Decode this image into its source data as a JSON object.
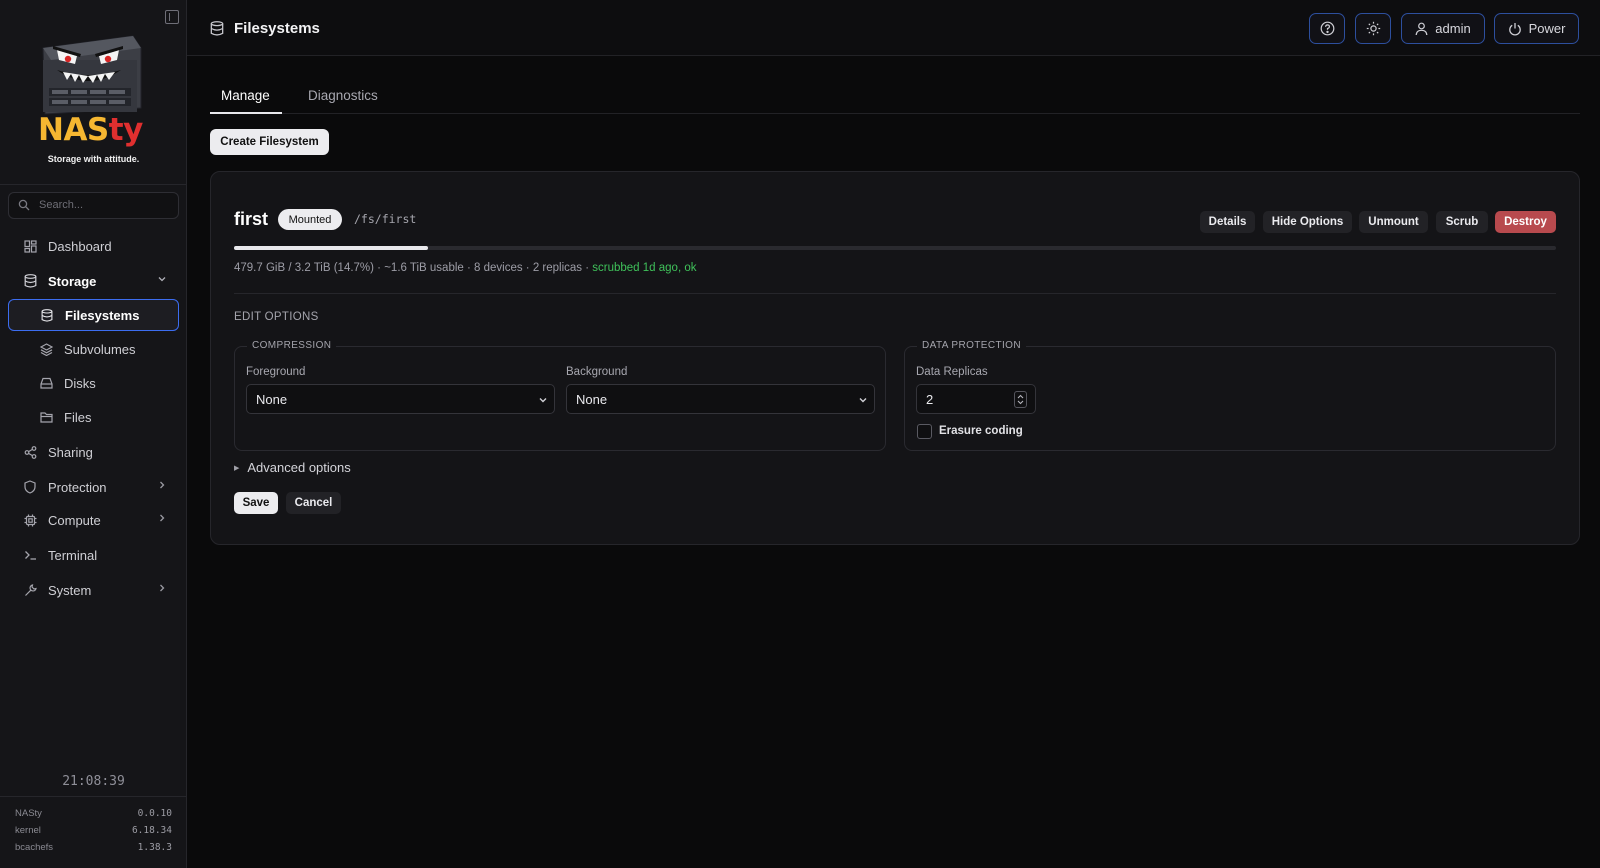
{
  "brand": {
    "name_main": "NAS",
    "name_accent": "ty",
    "tagline": "Storage with attitude."
  },
  "sidebar": {
    "search_placeholder": "Search...",
    "items": [
      {
        "label": "Dashboard",
        "icon": "dashboard-icon"
      },
      {
        "label": "Storage",
        "icon": "database-icon",
        "expanded": true
      },
      {
        "label": "Filesystems",
        "icon": "database-icon",
        "active": true
      },
      {
        "label": "Subvolumes",
        "icon": "layers-icon"
      },
      {
        "label": "Disks",
        "icon": "hard-drive-icon"
      },
      {
        "label": "Files",
        "icon": "folder-icon"
      },
      {
        "label": "Sharing",
        "icon": "share-icon"
      },
      {
        "label": "Protection",
        "icon": "shield-icon"
      },
      {
        "label": "Compute",
        "icon": "cpu-icon"
      },
      {
        "label": "Terminal",
        "icon": "terminal-icon"
      },
      {
        "label": "System",
        "icon": "wrench-icon"
      }
    ],
    "clock": "21:08:39",
    "versions": [
      {
        "name": "NASty",
        "value": "0.0.10"
      },
      {
        "name": "kernel",
        "value": "6.18.34"
      },
      {
        "name": "bcachefs",
        "value": "1.38.3"
      }
    ]
  },
  "topbar": {
    "title": "Filesystems",
    "user_label": "admin",
    "power_label": "Power"
  },
  "tabs": [
    {
      "label": "Manage",
      "active": true
    },
    {
      "label": "Diagnostics",
      "active": false
    }
  ],
  "create_button": "Create Filesystem",
  "filesystem": {
    "name": "first",
    "status": "Mounted",
    "mount_path": "/fs/first",
    "usage_fraction": 0.147,
    "stats_text": "479.7 GiB / 3.2 TiB (14.7%) · ~1.6 TiB usable · 8 devices · 2 replicas · ",
    "scrub_text": "scrubbed 1d ago, ok",
    "actions": {
      "details": "Details",
      "hide_options": "Hide Options",
      "unmount": "Unmount",
      "scrub": "Scrub",
      "destroy": "Destroy"
    }
  },
  "edit_options": {
    "title": "EDIT OPTIONS",
    "compression": {
      "legend": "COMPRESSION",
      "foreground_label": "Foreground",
      "foreground_value": "None",
      "background_label": "Background",
      "background_value": "None"
    },
    "data_protection": {
      "legend": "DATA PROTECTION",
      "replicas_label": "Data Replicas",
      "replicas_value": "2",
      "erasure_label": "Erasure coding",
      "erasure_checked": false
    },
    "advanced_label": "Advanced options",
    "save_label": "Save",
    "cancel_label": "Cancel"
  },
  "colors": {
    "accent": "#3c6df0",
    "brand_yellow": "#f6b731",
    "brand_red": "#e02f2f",
    "danger": "#b84a4e",
    "ok": "#3fc15a"
  }
}
